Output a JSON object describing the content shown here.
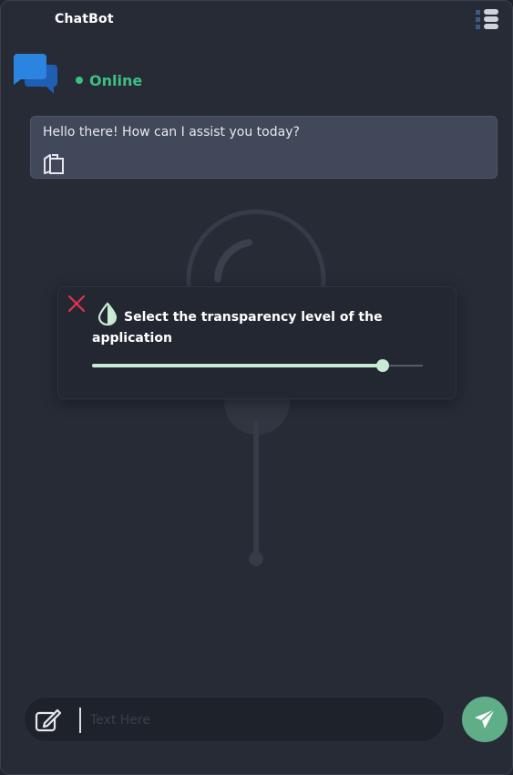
{
  "app": {
    "title": "ChatBot"
  },
  "header": {
    "status": "Online"
  },
  "messages": [
    {
      "sender": "bot",
      "text": "Hello there! How can I assist you today?"
    }
  ],
  "dialog": {
    "text": "Select the transparency level of the application",
    "slider_value": 0.88
  },
  "composer": {
    "placeholder": "Text Here"
  },
  "colors": {
    "accent": "#3fbf7f",
    "slider": "#c8ecd3",
    "send": "#5fae87",
    "close": "#e0334f",
    "logo_front": "#2a84e0",
    "logo_back": "#1e5fb3"
  },
  "icons": {
    "menu": "menu-icon",
    "logo": "chat-bubbles-icon",
    "copy": "copy-icon",
    "close": "close-icon",
    "opacity": "opacity-drop-icon",
    "edit": "edit-icon",
    "send": "send-icon",
    "background": "microphone-icon"
  }
}
